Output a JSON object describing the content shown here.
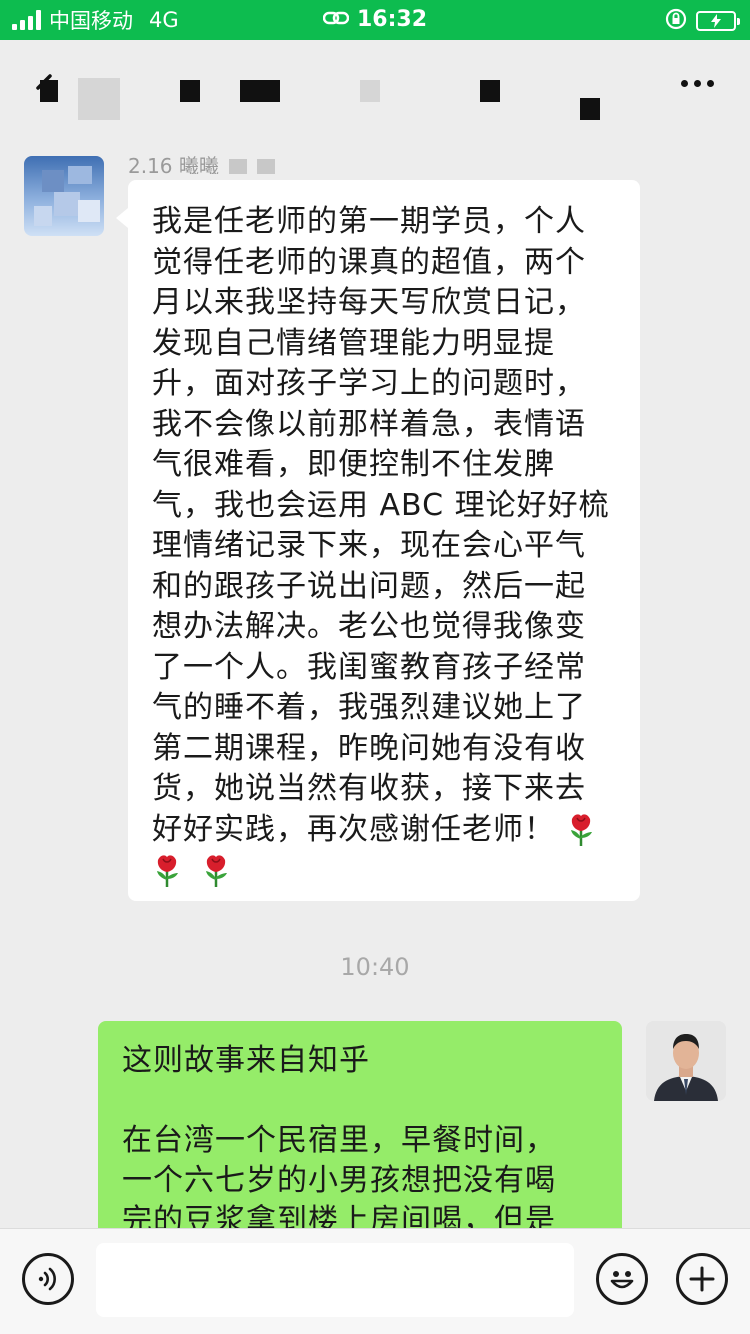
{
  "status_bar": {
    "carrier": "中国移动",
    "network": "4G",
    "time": "16:32"
  },
  "header": {
    "title": ""
  },
  "incoming": {
    "sender_visible_fragment": "2.16 曦曦",
    "message_lines": [
      "我是任老师的第一期学员，个人",
      "觉得任老师的课真的超值，两个",
      "月以来我坚持每天写欣赏日记，",
      "发现自己情绪管理能力明显提",
      "升，面对孩子学习上的问题时，",
      "我不会像以前那样着急，表情语",
      "气很难看，即便控制不住发脾",
      "气，我也会运用 ABC 理论好好梳",
      "理情绪记录下来，现在会心平气",
      "和的跟孩子说出问题，然后一起",
      "想办法解决。老公也觉得我像变",
      "了一个人。我闺蜜教育孩子经常",
      "气的睡不着，我强烈建议她上了",
      "第二期课程，昨晚问她有没有收",
      "货，她说当然有收获，接下来去",
      "好好实践，再次感谢任老师！"
    ],
    "emoji": "rose-icon"
  },
  "timestamp": "10:40",
  "outgoing": {
    "line1": "这则故事来自知乎",
    "line2": "在台湾一个民宿里，早餐时间，",
    "line3": "一个六七岁的小男孩想把没有喝",
    "line4": "完的豆浆拿到楼上房间喝，但是"
  },
  "input_bar": {
    "voice_icon": "voice-icon",
    "emoji_icon": "emoji-icon",
    "plus_icon": "plus-icon"
  }
}
